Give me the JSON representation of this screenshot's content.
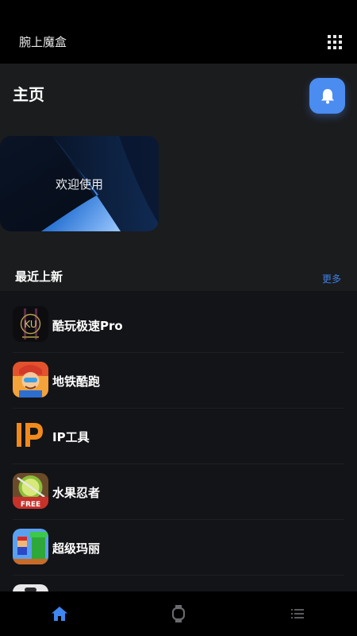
{
  "app_bar": {
    "title": "腕上魔盒"
  },
  "page": {
    "title": "主页"
  },
  "banner": {
    "text": "欢迎使用"
  },
  "recent": {
    "title": "最近上新",
    "more_label": "更多",
    "items": [
      {
        "name": "酷玩极速Pro",
        "icon": "ku-logo-icon"
      },
      {
        "name": "地铁酷跑",
        "icon": "subway-surfers-icon"
      },
      {
        "name": "IP工具",
        "icon": "ip-logo-icon"
      },
      {
        "name": "水果忍者",
        "icon": "fruit-ninja-icon"
      },
      {
        "name": "超级玛丽",
        "icon": "super-mario-icon"
      }
    ]
  },
  "nav": {
    "tabs": [
      {
        "icon": "home-icon",
        "active": true
      },
      {
        "icon": "watch-icon",
        "active": false
      },
      {
        "icon": "list-icon",
        "active": false
      }
    ]
  },
  "colors": {
    "accent": "#4a8cf0",
    "background": "#1b1c1e",
    "bar": "#000000"
  }
}
